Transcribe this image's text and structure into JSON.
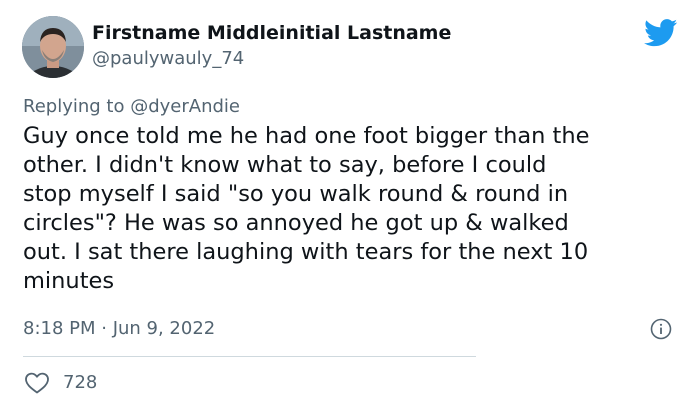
{
  "author": {
    "display_name": "Firstname Middleinitial Lastname",
    "handle": "@paulywauly_74",
    "avatar_icon": "user-avatar"
  },
  "platform_icon": "twitter-bird-icon",
  "reply": {
    "prefix": "Replying to ",
    "mention": "@dyerAndie"
  },
  "body": "Guy once told me he had one foot bigger than the\nother. I didn't know what to say, before I could\nstop myself I said \"so you walk round & round in\ncircles\"? He was so annoyed he got up & walked\nout. I sat there laughing with tears for the next 10\nminutes",
  "timestamp": "8:18 PM · Jun 9, 2022",
  "likes": {
    "count": "728",
    "icon": "heart-icon"
  },
  "colors": {
    "text": "#0f1419",
    "secondary": "#536471",
    "twitter_blue": "#1d9bf0",
    "divider": "#cfd9de"
  }
}
